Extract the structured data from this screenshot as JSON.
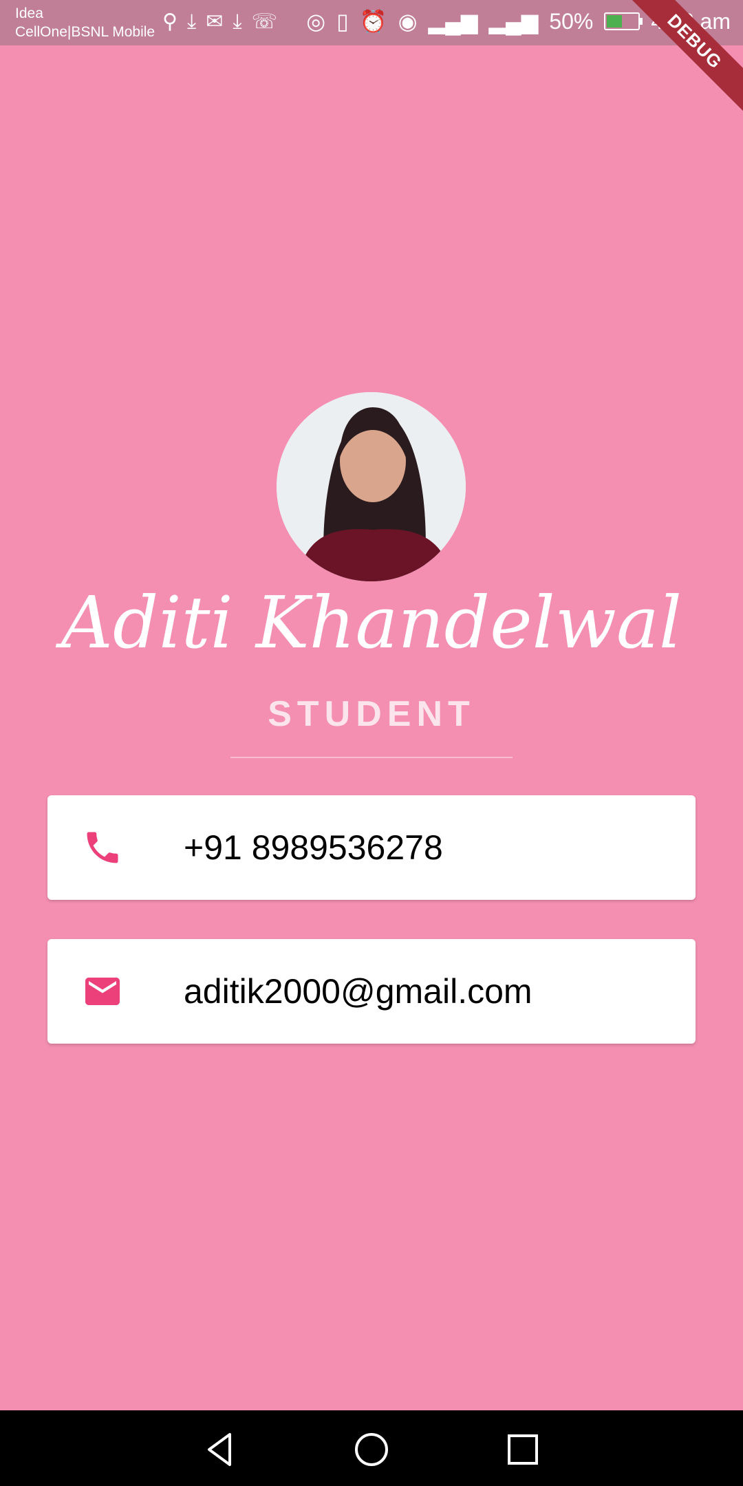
{
  "status_bar": {
    "carrier_line1": "Idea",
    "carrier_line2": "CellOne|BSNL Mobile",
    "battery_percent": "50%",
    "battery_level": 0.5,
    "time": "4:12 am",
    "debug_label": "DEBUG"
  },
  "profile": {
    "name": "Aditi Khandelwal",
    "role": "STUDENT"
  },
  "contacts": [
    {
      "icon": "phone-icon",
      "value": "+91 8989536278"
    },
    {
      "icon": "email-icon",
      "value": "aditik2000@gmail.com"
    }
  ],
  "colors": {
    "background": "#f48fb1",
    "accent": "#ec407a",
    "card": "#ffffff"
  }
}
